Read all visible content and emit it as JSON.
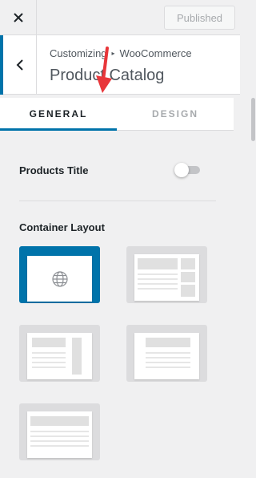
{
  "topbar": {
    "close_icon": "close-icon",
    "publish_label": "Published"
  },
  "section": {
    "back_icon": "chevron-left-icon",
    "breadcrumb_root": "Customizing",
    "breadcrumb_separator_icon": "triangle-right-icon",
    "breadcrumb_parent": "WooCommerce",
    "title": "Product Catalog"
  },
  "tabs": [
    {
      "label": "GENERAL",
      "active": true
    },
    {
      "label": "DESIGN",
      "active": false
    }
  ],
  "settings": {
    "products_title_label": "Products Title",
    "products_title_enabled": false,
    "container_layout_label": "Container Layout",
    "layout_options": [
      {
        "name": "default",
        "icon": "globe-icon",
        "selected": true
      },
      {
        "name": "boxed-right-sidebar",
        "selected": false
      },
      {
        "name": "content-right-sidebar",
        "selected": false
      },
      {
        "name": "boxed-no-sidebar",
        "selected": false
      },
      {
        "name": "full-width",
        "selected": false
      }
    ]
  },
  "colors": {
    "accent": "#0073aa",
    "annotation_arrow": "#e8363a"
  }
}
